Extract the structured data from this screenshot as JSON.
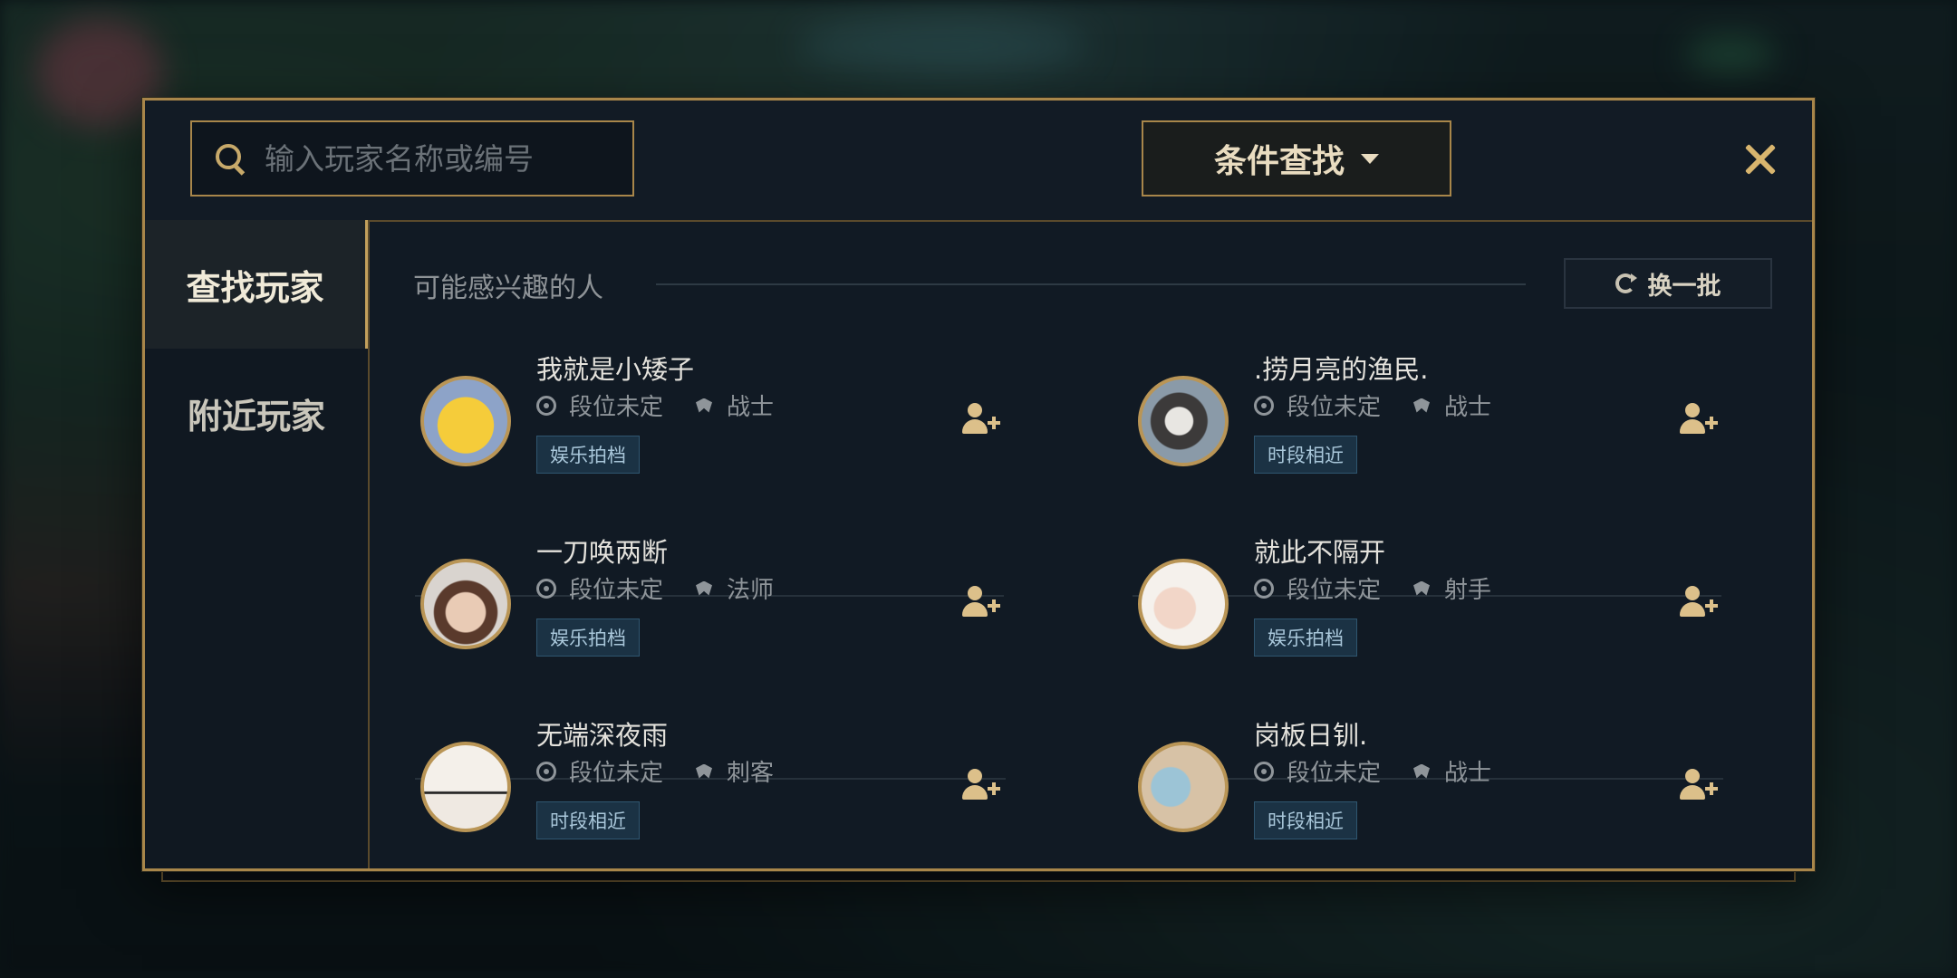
{
  "colors": {
    "accent_gold": "#a8864a",
    "tag_bg": "#1b3244",
    "panel_bg": "#111a24"
  },
  "search": {
    "placeholder": "输入玩家名称或编号",
    "icon": "search-icon"
  },
  "filter": {
    "label": "条件查找",
    "icon": "caret-down-icon"
  },
  "sidebar": {
    "items": [
      {
        "label": "查找玩家",
        "active": true
      },
      {
        "label": "附近玩家",
        "active": false
      }
    ]
  },
  "section": {
    "title": "可能感兴趣的人",
    "refresh_label": "换一批"
  },
  "players": [
    {
      "name": "我就是小矮子",
      "rank": "段位未定",
      "role": "战士",
      "tag": "娱乐拍档",
      "avatar_color": "#e3b43a"
    },
    {
      "name": ".捞月亮的渔民.",
      "rank": "段位未定",
      "role": "战士",
      "tag": "时段相近",
      "avatar_color": "#6f6a66"
    },
    {
      "name": "一刀唤两断",
      "rank": "段位未定",
      "role": "法师",
      "tag": "娱乐拍档",
      "avatar_color": "#c7a490"
    },
    {
      "name": "就此不隔开",
      "rank": "段位未定",
      "role": "射手",
      "tag": "娱乐拍档",
      "avatar_color": "#e8ddd4"
    },
    {
      "name": "无端深夜雨",
      "rank": "段位未定",
      "role": "刺客",
      "tag": "时段相近",
      "avatar_color": "#efe8e0"
    },
    {
      "name": "岗板日钏.",
      "rank": "段位未定",
      "role": "战士",
      "tag": "时段相近",
      "avatar_color": "#c9b59c"
    }
  ]
}
